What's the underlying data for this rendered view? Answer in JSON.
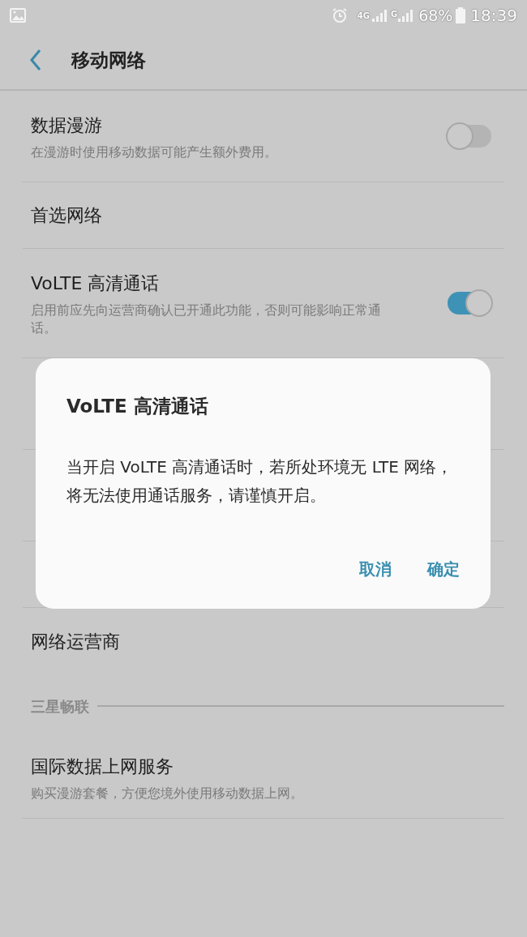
{
  "status_bar": {
    "network_1": "4G",
    "network_2": "G",
    "battery": "68%",
    "time": "18:39"
  },
  "header": {
    "title": "移动网络"
  },
  "settings": [
    {
      "kind": "switch",
      "title": "数据漫游",
      "subtitle": "在漫游时使用移动数据可能产生额外费用。",
      "on": false
    },
    {
      "kind": "plain",
      "title": "首选网络"
    },
    {
      "kind": "switch",
      "title": "VoLTE 高清通话",
      "subtitle": "启用前应先向运营商确认已开通此功能，否则可能影响正常通话。",
      "on": true
    }
  ],
  "settings_after_dialog": [
    {
      "title": "网络运营商"
    }
  ],
  "section": {
    "title": "三星畅联",
    "items": [
      {
        "title": "国际数据上网服务",
        "subtitle": "购买漫游套餐，方便您境外使用移动数据上网。"
      }
    ]
  },
  "dialog": {
    "title": "VoLTE 高清通话",
    "message": "当开启 VoLTE 高清通话时，若所处环境无 LTE 网络，将无法使用通话服务，请谨慎开启。",
    "buttons": [
      "取消",
      "确定"
    ]
  }
}
